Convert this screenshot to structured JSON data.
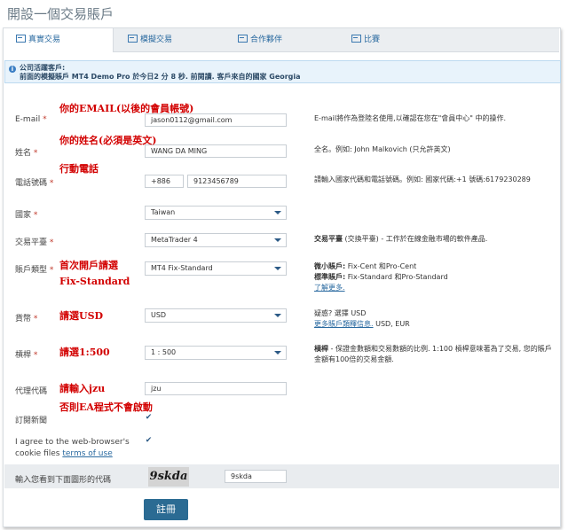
{
  "title": "開設一個交易賬戶",
  "tabs": [
    {
      "label": "真實交易"
    },
    {
      "label": "模擬交易"
    },
    {
      "label": "合作夥伴"
    },
    {
      "label": "比賽"
    }
  ],
  "notice": {
    "heading": "公司活躍客戶:",
    "text": "前面的模擬賬戶 MT4 Demo Pro 於今日2 分 8 秒. 前閱讀. 客戶來自的國家 Georgia"
  },
  "form": {
    "email": {
      "label": "E-mail",
      "value": "jason0112@gmail.com",
      "note": "E-mail將作為登陸名使用,以確認在您在\"會員中心\" 中的操作."
    },
    "name": {
      "label": "姓名",
      "value": "WANG DA MING",
      "note": "全名。例如: John Malkovich (只允許英文)"
    },
    "phone": {
      "label": "電話號碼",
      "code": "+886",
      "number": "9123456789",
      "note": "請輸入國家代碼和電話號碼。例如: 國家代碼:+1 號碼:6179230289"
    },
    "country": {
      "label": "國家",
      "value": "Taiwan"
    },
    "platform": {
      "label": "交易平臺",
      "value": "MetaTrader 4",
      "note_bold": "交易平臺",
      "note_rest": " (交換平臺) - 工作於在線金融市場的軟件產品."
    },
    "account_type": {
      "label": "賬戶類型",
      "value": "MT4 Fix-Standard",
      "note1_bold": "微小賬戶:",
      "note1_rest": " Fix-Cent 和Pro-Cent",
      "note2_bold": "標準賬戶:",
      "note2_rest": " Fix-Standard 和Pro-Standard",
      "more": "了解更多."
    },
    "currency": {
      "label": "貨幣",
      "value": "USD",
      "note_line1": "疑惑? 選擇 USD",
      "note_link": "更多賬戶類釋信息.",
      "note_rest": " USD, EUR"
    },
    "leverage": {
      "label": "槓桿",
      "value": "1 : 500",
      "note_bold": "槓桿",
      "note_rest": " - 保證金數額和交易數額的比例. 1:100 槓桿意味著為了交易, 您的賬戶金額有100倍的交易金額."
    },
    "agent": {
      "label": "代理代碼",
      "value": "jzu"
    },
    "newsletter": {
      "label": "訂閱新聞"
    },
    "agree": {
      "line1": "I agree to the web-browser's",
      "line2": "cookie files",
      "link": "terms of use"
    },
    "captcha": {
      "label": "輸入您看到下面圖形的代碼",
      "image_text": "9skda",
      "value": "9skda"
    },
    "submit": "註冊"
  },
  "annotations": {
    "email": "你的EMAIL(以後的會員帳號)",
    "name": "你的姓名(必須是英文)",
    "phone": "行動電話",
    "account_type_1": "首次開戶請選",
    "account_type_2": "Fix-Standard",
    "currency": "請選USD",
    "leverage": "請選1:500",
    "agent_1": "請輸入jzu",
    "agent_2": "否則EA程式不會啟動"
  },
  "colors": {
    "accent": "#2b6b93",
    "annotation": "#d20000",
    "notice_bg": "#e8f3fb"
  }
}
